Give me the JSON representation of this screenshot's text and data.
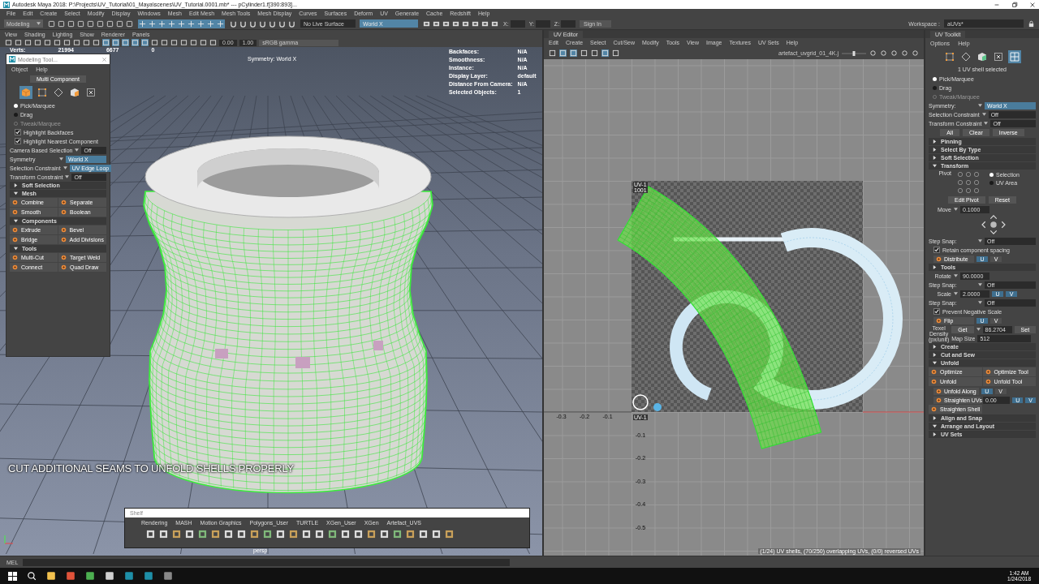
{
  "window": {
    "title": "Autodesk Maya 2018: P:\\Projects\\UV_Tutorial\\01_Maya\\scenes\\UV_Tutorial.0001.mb*   ---   pCylinder1.f[390:893]..."
  },
  "menu": [
    "File",
    "Edit",
    "Create",
    "Select",
    "Modify",
    "Display",
    "Windows",
    "Mesh",
    "Edit Mesh",
    "Mesh Tools",
    "Mesh Display",
    "Curves",
    "Surfaces",
    "Deform",
    "UV",
    "Generate",
    "Cache",
    "Redshift",
    "Help"
  ],
  "toolbar": {
    "mode": "Modeling",
    "live_surface": "No Live Surface",
    "symmetry": "World X",
    "coords": [
      "X:",
      "Y:",
      "Z:"
    ],
    "sign_in": "Sign In",
    "workspace_label": "Workspace :",
    "workspace": "aUVs*"
  },
  "viewport": {
    "menu": [
      "View",
      "Shading",
      "Lighting",
      "Show",
      "Renderer",
      "Panels"
    ],
    "exposure": "0.00",
    "gamma": "1.00",
    "color_space": "sRGB gamma",
    "stats": [
      "Verts:",
      "21994",
      "6677",
      "0"
    ],
    "symmetry_note": "Symmetry: World X",
    "hud": [
      {
        "label": "Backfaces:",
        "value": "N/A"
      },
      {
        "label": "Smoothness:",
        "value": "N/A"
      },
      {
        "label": "Instance:",
        "value": "N/A"
      },
      {
        "label": "Display Layer:",
        "value": "default"
      },
      {
        "label": "Distance From Camera:",
        "value": "N/A"
      },
      {
        "label": "Selected Objects:",
        "value": "1"
      }
    ],
    "caption": "CUT ADDITIONAL SEAMS TO UNFOLD SHELLS PROPERLY",
    "camera": "persp"
  },
  "modeling_toolkit": {
    "title": "Modeling Tool...",
    "menu": [
      "Object",
      "Help"
    ],
    "rows": [
      {
        "kind": "buttons",
        "items": [
          "Multi Component"
        ]
      },
      {
        "kind": "modes",
        "items": [
          {
            "kind": "object",
            "selected": true
          },
          {
            "kind": "vertex",
            "selected": false
          },
          {
            "kind": "edge",
            "selected": false
          },
          {
            "kind": "face",
            "selected": false
          },
          {
            "kind": "uv",
            "selected": false
          }
        ]
      },
      {
        "kind": "radio",
        "label": "Pick/Marquee",
        "selected": true,
        "disabled": false
      },
      {
        "kind": "radio",
        "label": "Drag",
        "selected": false,
        "disabled": false
      },
      {
        "kind": "radio",
        "label": "Tweak/Marquee",
        "selected": false,
        "disabled": true
      },
      {
        "kind": "check",
        "label": "Highlight Backfaces",
        "checked": true
      },
      {
        "kind": "check",
        "label": "Highlight Nearest Component",
        "checked": true
      },
      {
        "kind": "option",
        "label": "Camera Based Selection",
        "value": "Off",
        "active": false
      },
      {
        "kind": "option",
        "label": "Symmetry",
        "value": "World X",
        "active": true
      },
      {
        "kind": "option",
        "label": "Selection Constraint",
        "value": "UV Edge Loop",
        "active": true
      },
      {
        "kind": "option",
        "label": "Transform Constraint",
        "value": "Off",
        "active": false
      },
      {
        "kind": "section",
        "label": "Soft Selection",
        "expanded": false
      },
      {
        "kind": "section",
        "label": "Mesh",
        "expanded": true
      },
      {
        "kind": "tools",
        "items": [
          "Combine",
          "Separate",
          "Smooth",
          "Boolean"
        ]
      },
      {
        "kind": "section",
        "label": "Components",
        "expanded": true
      },
      {
        "kind": "tools",
        "items": [
          "Extrude",
          "Bevel",
          "Bridge",
          "Add Divisions"
        ]
      },
      {
        "kind": "section",
        "label": "Tools",
        "expanded": true
      },
      {
        "kind": "tools",
        "items": [
          "Multi-Cut",
          "Target Weld",
          "Connect",
          "Quad Draw"
        ]
      }
    ]
  },
  "shelf": {
    "title": "Shelf",
    "tabs": [
      "Rendering",
      "MASH",
      "Motion Graphics",
      "Polygons_User",
      "TURTLE",
      "XGen_User",
      "XGen",
      "Artefact_UVS"
    ]
  },
  "uv_editor": {
    "title": "UV Editor",
    "menu": [
      "Edit",
      "Create",
      "Select",
      "Cut/Sew",
      "Modify",
      "Tools",
      "View",
      "Image",
      "Textures",
      "UV Sets",
      "Help"
    ],
    "texture": "artefact_uvgrid_01_4K.j",
    "tile_labels": [
      "UV-1",
      "1001"
    ],
    "u_ticks": [
      "-0.3",
      "-0.2",
      "-0.1"
    ],
    "origin_label": "UV-1",
    "v_ticks": [
      "-0.1",
      "-0.2",
      "-0.3",
      "-0.4",
      "-0.5"
    ],
    "status": "(1/24) UV shells, (70/250) overlapping UVs, (0/0) reversed UVs"
  },
  "uv_toolkit": {
    "title": "UV Toolkit",
    "menu": [
      "Options",
      "Help"
    ],
    "rows": [
      {
        "kind": "modes",
        "items": [
          {
            "kind": "vertex",
            "selected": false
          },
          {
            "kind": "edge",
            "selected": false
          },
          {
            "kind": "shell",
            "selected": false
          },
          {
            "kind": "uv",
            "selected": false
          },
          {
            "kind": "grid",
            "selected": true
          }
        ]
      },
      {
        "kind": "note",
        "text": "1 UV shell selected"
      },
      {
        "kind": "radio",
        "label": "Pick/Marquee",
        "selected": true,
        "disabled": false
      },
      {
        "kind": "radio",
        "label": "Drag",
        "selected": false,
        "disabled": false
      },
      {
        "kind": "radio",
        "label": "Tweak/Marquee",
        "selected": false,
        "disabled": true
      },
      {
        "kind": "option",
        "label": "Symmetry:",
        "value": "World X",
        "active": true
      },
      {
        "kind": "option",
        "label": "Selection Constraint",
        "value": "Off",
        "active": false
      },
      {
        "kind": "option",
        "label": "Transform Constraint",
        "value": "Off",
        "active": false
      },
      {
        "kind": "buttons",
        "items": [
          "All",
          "Clear",
          "Inverse"
        ]
      },
      {
        "kind": "section",
        "label": "Pinning",
        "expanded": false
      },
      {
        "kind": "section",
        "label": "Select By Type",
        "expanded": false
      },
      {
        "kind": "section",
        "label": "Soft Selection",
        "expanded": false
      },
      {
        "kind": "section",
        "label": "Transform",
        "expanded": true
      },
      {
        "kind": "pivot",
        "label": "Pivot",
        "options": [
          {
            "label": "Selection",
            "selected": true
          },
          {
            "label": "UV Area",
            "selected": false
          }
        ]
      },
      {
        "kind": "buttons",
        "items": [
          "Edit Pivot",
          "Reset"
        ]
      },
      {
        "kind": "move",
        "label": "Move",
        "value": "0.1000"
      },
      {
        "kind": "option",
        "label": "Step Snap:",
        "value": "Off",
        "active": false
      },
      {
        "kind": "check",
        "label": "Retain component spacing",
        "checked": true
      },
      {
        "kind": "axis",
        "label": "Distribute",
        "axes": [
          {
            "label": "U",
            "selected": true
          },
          {
            "label": "V",
            "selected": false
          }
        ]
      },
      {
        "kind": "section",
        "label": "Tools",
        "expanded": false
      },
      {
        "kind": "numeric",
        "label": "Rotate",
        "value": "90.0000"
      },
      {
        "kind": "option",
        "label": "Step Snap:",
        "value": "Off",
        "active": false
      },
      {
        "kind": "numeric",
        "label": "Scale",
        "value": "2.0000",
        "axes": [
          {
            "label": "U",
            "selected": true
          },
          {
            "label": "V",
            "selected": true
          }
        ]
      },
      {
        "kind": "option",
        "label": "Step Snap:",
        "value": "Off",
        "active": false
      },
      {
        "kind": "check",
        "label": "Prevent Negative Scale",
        "checked": true
      },
      {
        "kind": "axis",
        "label": "Flip",
        "axes": [
          {
            "label": "U",
            "selected": true
          },
          {
            "label": "V",
            "selected": false
          }
        ]
      },
      {
        "kind": "texel",
        "label": "Texel Density (px/unit)",
        "get": "Get",
        "value": "86.2704",
        "set": "Set",
        "map_label": "Map Size",
        "map_value": "512"
      },
      {
        "kind": "section",
        "label": "Create",
        "expanded": false
      },
      {
        "kind": "section",
        "label": "Cut and Sew",
        "expanded": false
      },
      {
        "kind": "section",
        "label": "Unfold",
        "expanded": true
      },
      {
        "kind": "tools",
        "items": [
          "Optimize",
          "Optimize Tool",
          "Unfold",
          "Unfold Tool"
        ]
      },
      {
        "kind": "axis",
        "label": "Unfold Along",
        "axes": [
          {
            "label": "U",
            "selected": true
          },
          {
            "label": "V",
            "selected": false
          }
        ]
      },
      {
        "kind": "axis",
        "label": "Straighten UVs",
        "value": "0.00",
        "axes": [
          {
            "label": "U",
            "selected": true
          },
          {
            "label": "V",
            "selected": true
          }
        ]
      },
      {
        "kind": "tools",
        "items": [
          "Straighten Shell"
        ]
      },
      {
        "kind": "section",
        "label": "Align and Snap",
        "expanded": false
      },
      {
        "kind": "section",
        "label": "Arrange and Layout",
        "expanded": true
      },
      {
        "kind": "section",
        "label": "UV Sets",
        "expanded": false
      }
    ]
  },
  "command_line": "MEL",
  "clock": {
    "time": "1:42 AM",
    "date": "1/24/2018"
  }
}
